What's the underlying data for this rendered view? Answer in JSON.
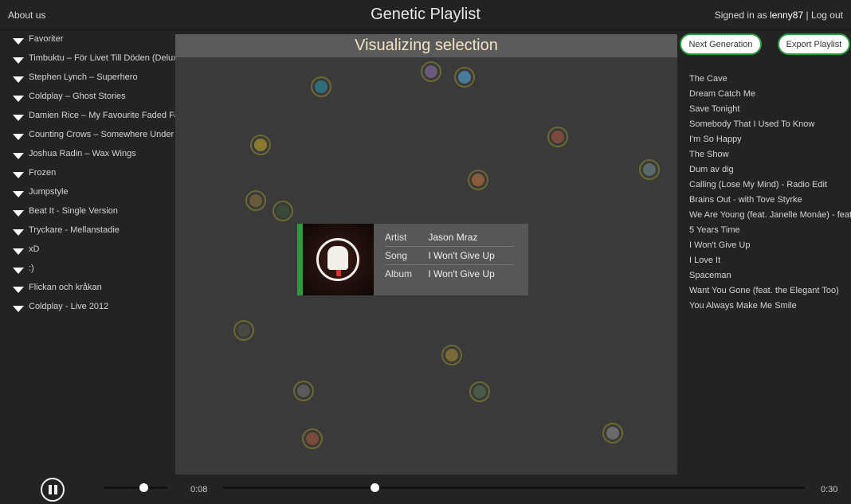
{
  "header": {
    "about_label": "About us",
    "app_title": "Genetic Playlist",
    "signed_in_prefix": "Signed in as",
    "username": "lenny87",
    "separator": "|",
    "logout_label": "Log out"
  },
  "sidebar": {
    "playlists": [
      {
        "label": "Favoriter"
      },
      {
        "label": "Timbuktu – För Livet Till Döden (Deluxe)"
      },
      {
        "label": "Stephen Lynch – Superhero"
      },
      {
        "label": "Coldplay – Ghost Stories"
      },
      {
        "label": "Damien Rice – My Favourite Faded Fantasy"
      },
      {
        "label": "Counting Crows – Somewhere Under Wonderland"
      },
      {
        "label": "Joshua Radin – Wax Wings"
      },
      {
        "label": "Frozen"
      },
      {
        "label": "Jumpstyle"
      },
      {
        "label": "Beat It - Single Version"
      },
      {
        "label": "Tryckare - Mellanstadie"
      },
      {
        "label": "xD"
      },
      {
        "label": ":)"
      },
      {
        "label": "Flickan och kråkan"
      },
      {
        "label": "Coldplay - Live 2012"
      }
    ]
  },
  "visualizer": {
    "header": "Visualizing selection",
    "bubbles": [
      {
        "name": "bubble-1",
        "color": "#2f6f7a"
      },
      {
        "name": "bubble-2",
        "color": "#6a5a7a"
      },
      {
        "name": "bubble-3",
        "color": "#4a7a9a"
      },
      {
        "name": "bubble-4",
        "color": "#8a7a30"
      },
      {
        "name": "bubble-5",
        "color": "#7a4a3a"
      },
      {
        "name": "bubble-6",
        "color": "#5a6a6a"
      },
      {
        "name": "bubble-7",
        "color": "#8a5a3a"
      },
      {
        "name": "bubble-8",
        "color": "#6a5a3a"
      },
      {
        "name": "bubble-9",
        "color": "#3a4a3a"
      },
      {
        "name": "bubble-10",
        "color": "#4a4a40"
      },
      {
        "name": "bubble-11",
        "color": "#7a6a3a"
      },
      {
        "name": "bubble-12",
        "color": "#5a5a5a"
      },
      {
        "name": "bubble-13",
        "color": "#4a5a4a"
      },
      {
        "name": "bubble-14",
        "color": "#7a4a3a"
      },
      {
        "name": "bubble-15",
        "color": "#6a6a6a"
      }
    ],
    "selected": {
      "artist_key": "Artist",
      "artist": "Jason Mraz",
      "song_key": "Song",
      "song": "I Won't Give Up",
      "album_key": "Album",
      "album": "I Won't Give Up",
      "accent_color": "#2f9b3f"
    }
  },
  "right_panel": {
    "next_generation_label": "Next Generation",
    "export_playlist_label": "Export Playlist",
    "songs": [
      {
        "title": "The Cave"
      },
      {
        "title": "Dream Catch Me"
      },
      {
        "title": "Save Tonight"
      },
      {
        "title": "Somebody That I Used To Know"
      },
      {
        "title": "I'm So Happy"
      },
      {
        "title": "The Show"
      },
      {
        "title": "Dum av dig"
      },
      {
        "title": "Calling (Lose My Mind) - Radio Edit"
      },
      {
        "title": "Brains Out - with Tove Styrke"
      },
      {
        "title": "We Are Young (feat. Janelle Monáe) - feat. Janelle Monae"
      },
      {
        "title": "5 Years Time"
      },
      {
        "title": "I Won't Give Up"
      },
      {
        "title": "I Love It"
      },
      {
        "title": "Spaceman"
      },
      {
        "title": "Want You Gone (feat. the Elegant Too)"
      },
      {
        "title": "You Always Make Me Smile"
      }
    ]
  },
  "player": {
    "state_icon": "pause-icon",
    "volume": 0.62,
    "elapsed": "0:08",
    "duration": "0:30",
    "progress": 0.26
  }
}
